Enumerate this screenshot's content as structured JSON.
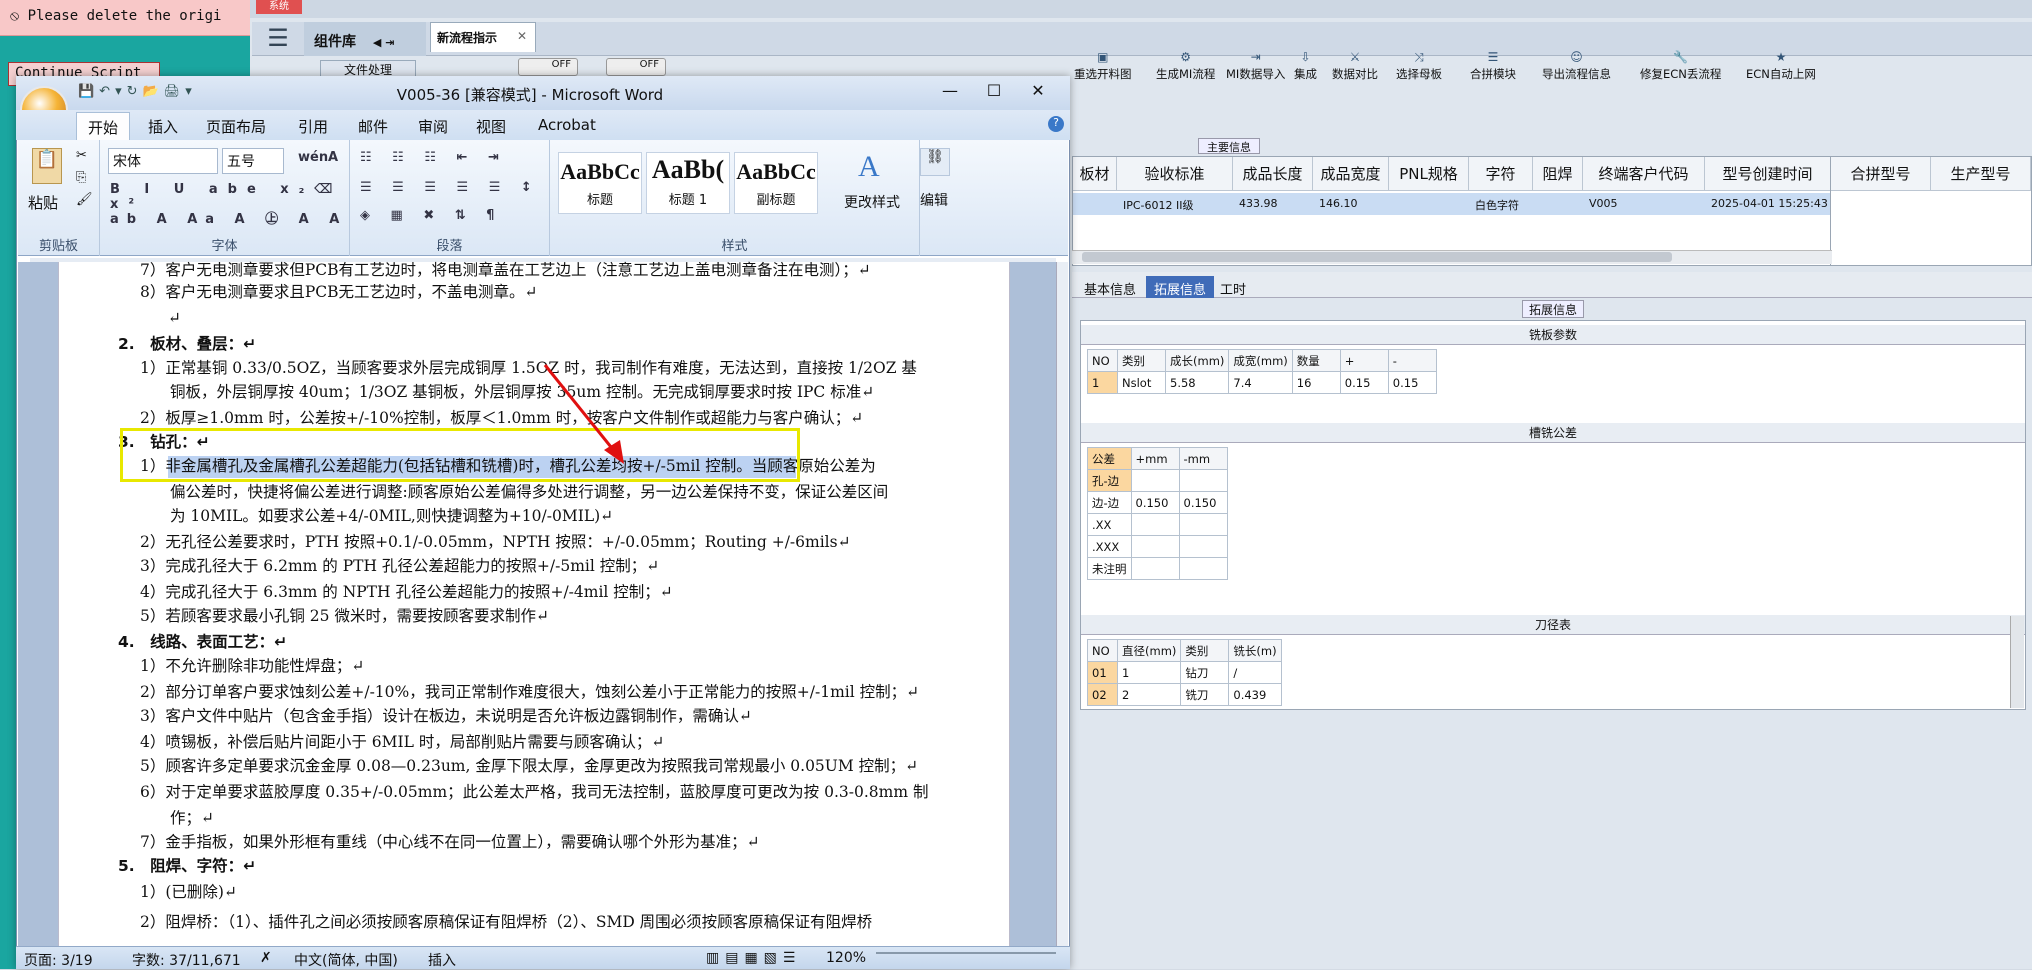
{
  "background": {
    "alert_text": "Please delete the origi",
    "continue_btn": "Continue Script",
    "sys_tag": "系统"
  },
  "erp": {
    "comp_lib": "组件库",
    "doc_tab": "文件处理",
    "flow_tab": "新流程指示",
    "toggle1": "OFF",
    "toggle2": "OFF",
    "toolbar": [
      {
        "label": "重选开料图",
        "icon": "▣"
      },
      {
        "label": "生成MI流程",
        "icon": "⚙"
      },
      {
        "label": "MI数据导入",
        "icon": "⇥"
      },
      {
        "label": "集成",
        "icon": "⇩"
      },
      {
        "label": "数据对比",
        "icon": "⚔"
      },
      {
        "label": "选择母板",
        "icon": "⤨"
      },
      {
        "label": "合拼模块",
        "icon": "☰"
      },
      {
        "label": "导出流程信息",
        "icon": "☺"
      },
      {
        "label": "修复ECN丢流程",
        "icon": "🔧"
      },
      {
        "label": "ECN自动上网",
        "icon": "★"
      }
    ],
    "main_info_label": "主要信息",
    "main_headers": [
      "板材",
      "验收标准",
      "成品长度",
      "成品宽度",
      "PNL规格",
      "字符",
      "阻焊",
      "终端客户代码",
      "型号创建时间"
    ],
    "main_row": [
      "",
      "IPC-6012 II级",
      "433.98",
      "146.10",
      "",
      "白色字符",
      "",
      "V005",
      "2025-04-01 15:25:43"
    ],
    "right_headers": [
      "合拼型号",
      "生产型号"
    ],
    "subtabs": [
      "基本信息",
      "拓展信息",
      "工时"
    ],
    "ext_label": "拓展信息",
    "mill_title": "铣板参数",
    "mill_headers": [
      "NO",
      "类别",
      "成长(mm)",
      "成宽(mm)",
      "数量",
      "+",
      "-"
    ],
    "mill_row": [
      "1",
      "Nslot",
      "5.58",
      "7.4",
      "16",
      "0.15",
      "0.15"
    ],
    "slot_title": "槽铣公差",
    "slot_headers": [
      "公差",
      "+mm",
      "-mm"
    ],
    "slot_rows": [
      [
        "孔-边",
        "",
        ""
      ],
      [
        "边-边",
        "0.150",
        "0.150"
      ],
      [
        ".XX",
        "",
        ""
      ],
      [
        ".XXX",
        "",
        ""
      ],
      [
        "未注明",
        "",
        ""
      ]
    ],
    "tool_title": "刀径表",
    "tool_headers": [
      "NO",
      "直径(mm)",
      "类别",
      "铣长(m)"
    ],
    "tool_rows": [
      [
        "01",
        "1",
        "钻刀",
        "/"
      ],
      [
        "02",
        "2",
        "铣刀",
        "0.439"
      ]
    ]
  },
  "word": {
    "title": "V005-36 [兼容模式] - Microsoft Word",
    "tabs": [
      "开始",
      "插入",
      "页面布局",
      "引用",
      "邮件",
      "审阅",
      "视图",
      "Acrobat"
    ],
    "font_name": "宋体",
    "font_size": "五号",
    "groups": [
      "剪贴板",
      "字体",
      "段落",
      "样式",
      "编辑"
    ],
    "paste": "粘贴",
    "styles": [
      {
        "sample": "AaBbCc",
        "name": "标题"
      },
      {
        "sample": "AaBb(",
        "name": "标题 1"
      },
      {
        "sample": "AaBbCc",
        "name": "副标题"
      }
    ],
    "change_styles": "更改样式",
    "edit": "编辑",
    "lines": [
      "7）客户无电测章要求但PCB有工艺边时，将电测章盖在工艺边上（注意工艺边上盖电测章备注在电测）；↵",
      "8）客户无电测章要求且PCB无工艺边时，不盖电测章。↵",
      "↵",
      "2.　板材、叠层：↵",
      "1）正常基铜 0.33/0.5OZ，当顾客要求外层完成铜厚 1.5OZ 时，我司制作有难度，无法达到，直接按 1/2OZ 基",
      "铜板，外层铜厚按 40um；1/3OZ 基铜板，外层铜厚按 35um 控制。无完成铜厚要求时按 IPC 标准↵",
      "2）板厚≥1.0mm 时，公差按+/-10%控制，板厚＜1.0mm 时，按客户文件制作或超能力与客户确认；↵",
      "3.　钻孔：↵",
      "1）非金属槽孔及金属槽孔公差超能力(包括钻槽和铣槽)时，槽孔公差均按+/-5mil 控制。当顾客原始公差为",
      "偏公差时，快捷将偏公差进行调整:顾客原始公差偏得多处进行调整，另一边公差保持不变，保证公差区间",
      "为 10MIL。如要求公差+4/-0MIL,则快捷调整为+10/-0MIL)↵",
      "2）无孔径公差要求时，PTH 按照+0.1/-0.05mm，NPTH 按照：+/-0.05mm；Routing +/-6mils↵",
      "3）完成孔径大于 6.2mm 的 PTH 孔径公差超能力的按照+/-5mil 控制；↵",
      "4）完成孔径大于 6.3mm 的 NPTH 孔径公差超能力的按照+/-4mil 控制；↵",
      "5）若顾客要求最小孔铜 25 微米时，需要按顾客要求制作↵",
      "4.　线路、表面工艺：↵",
      "1）不允许删除非功能性焊盘；↵",
      "2）部分订单客户要求蚀刻公差+/-10%，我司正常制作难度很大，蚀刻公差小于正常能力的按照+/-1mil 控制；↵",
      "3）客户文件中贴片（包含金手指）设计在板边，未说明是否允许板边露铜制作，需确认↵",
      "4）喷锡板，补偿后贴片间距小于 6MIL 时，局部削贴片需要与顾客确认；↵",
      "5）顾客许多定单要求沉金金厚 0.08—0.23um, 金厚下限太厚，金厚更改为按照我司常规最小 0.05UM 控制；↵",
      "6）对于定单要求蓝胶厚度 0.35+/-0.05mm；此公差太严格，我司无法控制，蓝胶厚度可更改为按 0.3-0.8mm 制",
      "作；↵",
      "7）金手指板，如果外形框有重线（中心线不在同一位置上），需要确认哪个外形为基准；↵",
      "5.　阻焊、字符：↵",
      "1）(已删除)↵",
      "2）阻焊桥：（1）、插件孔之间必须按顾客原稿保证有阻焊桥（2）、SMD 周围必须按顾客原稿保证有阻焊桥"
    ],
    "status": {
      "page": "页面: 3/19",
      "words": "字数: 37/11,671",
      "lang": "中文(简体, 中国)",
      "mode": "插入",
      "zoom": "120%"
    }
  }
}
